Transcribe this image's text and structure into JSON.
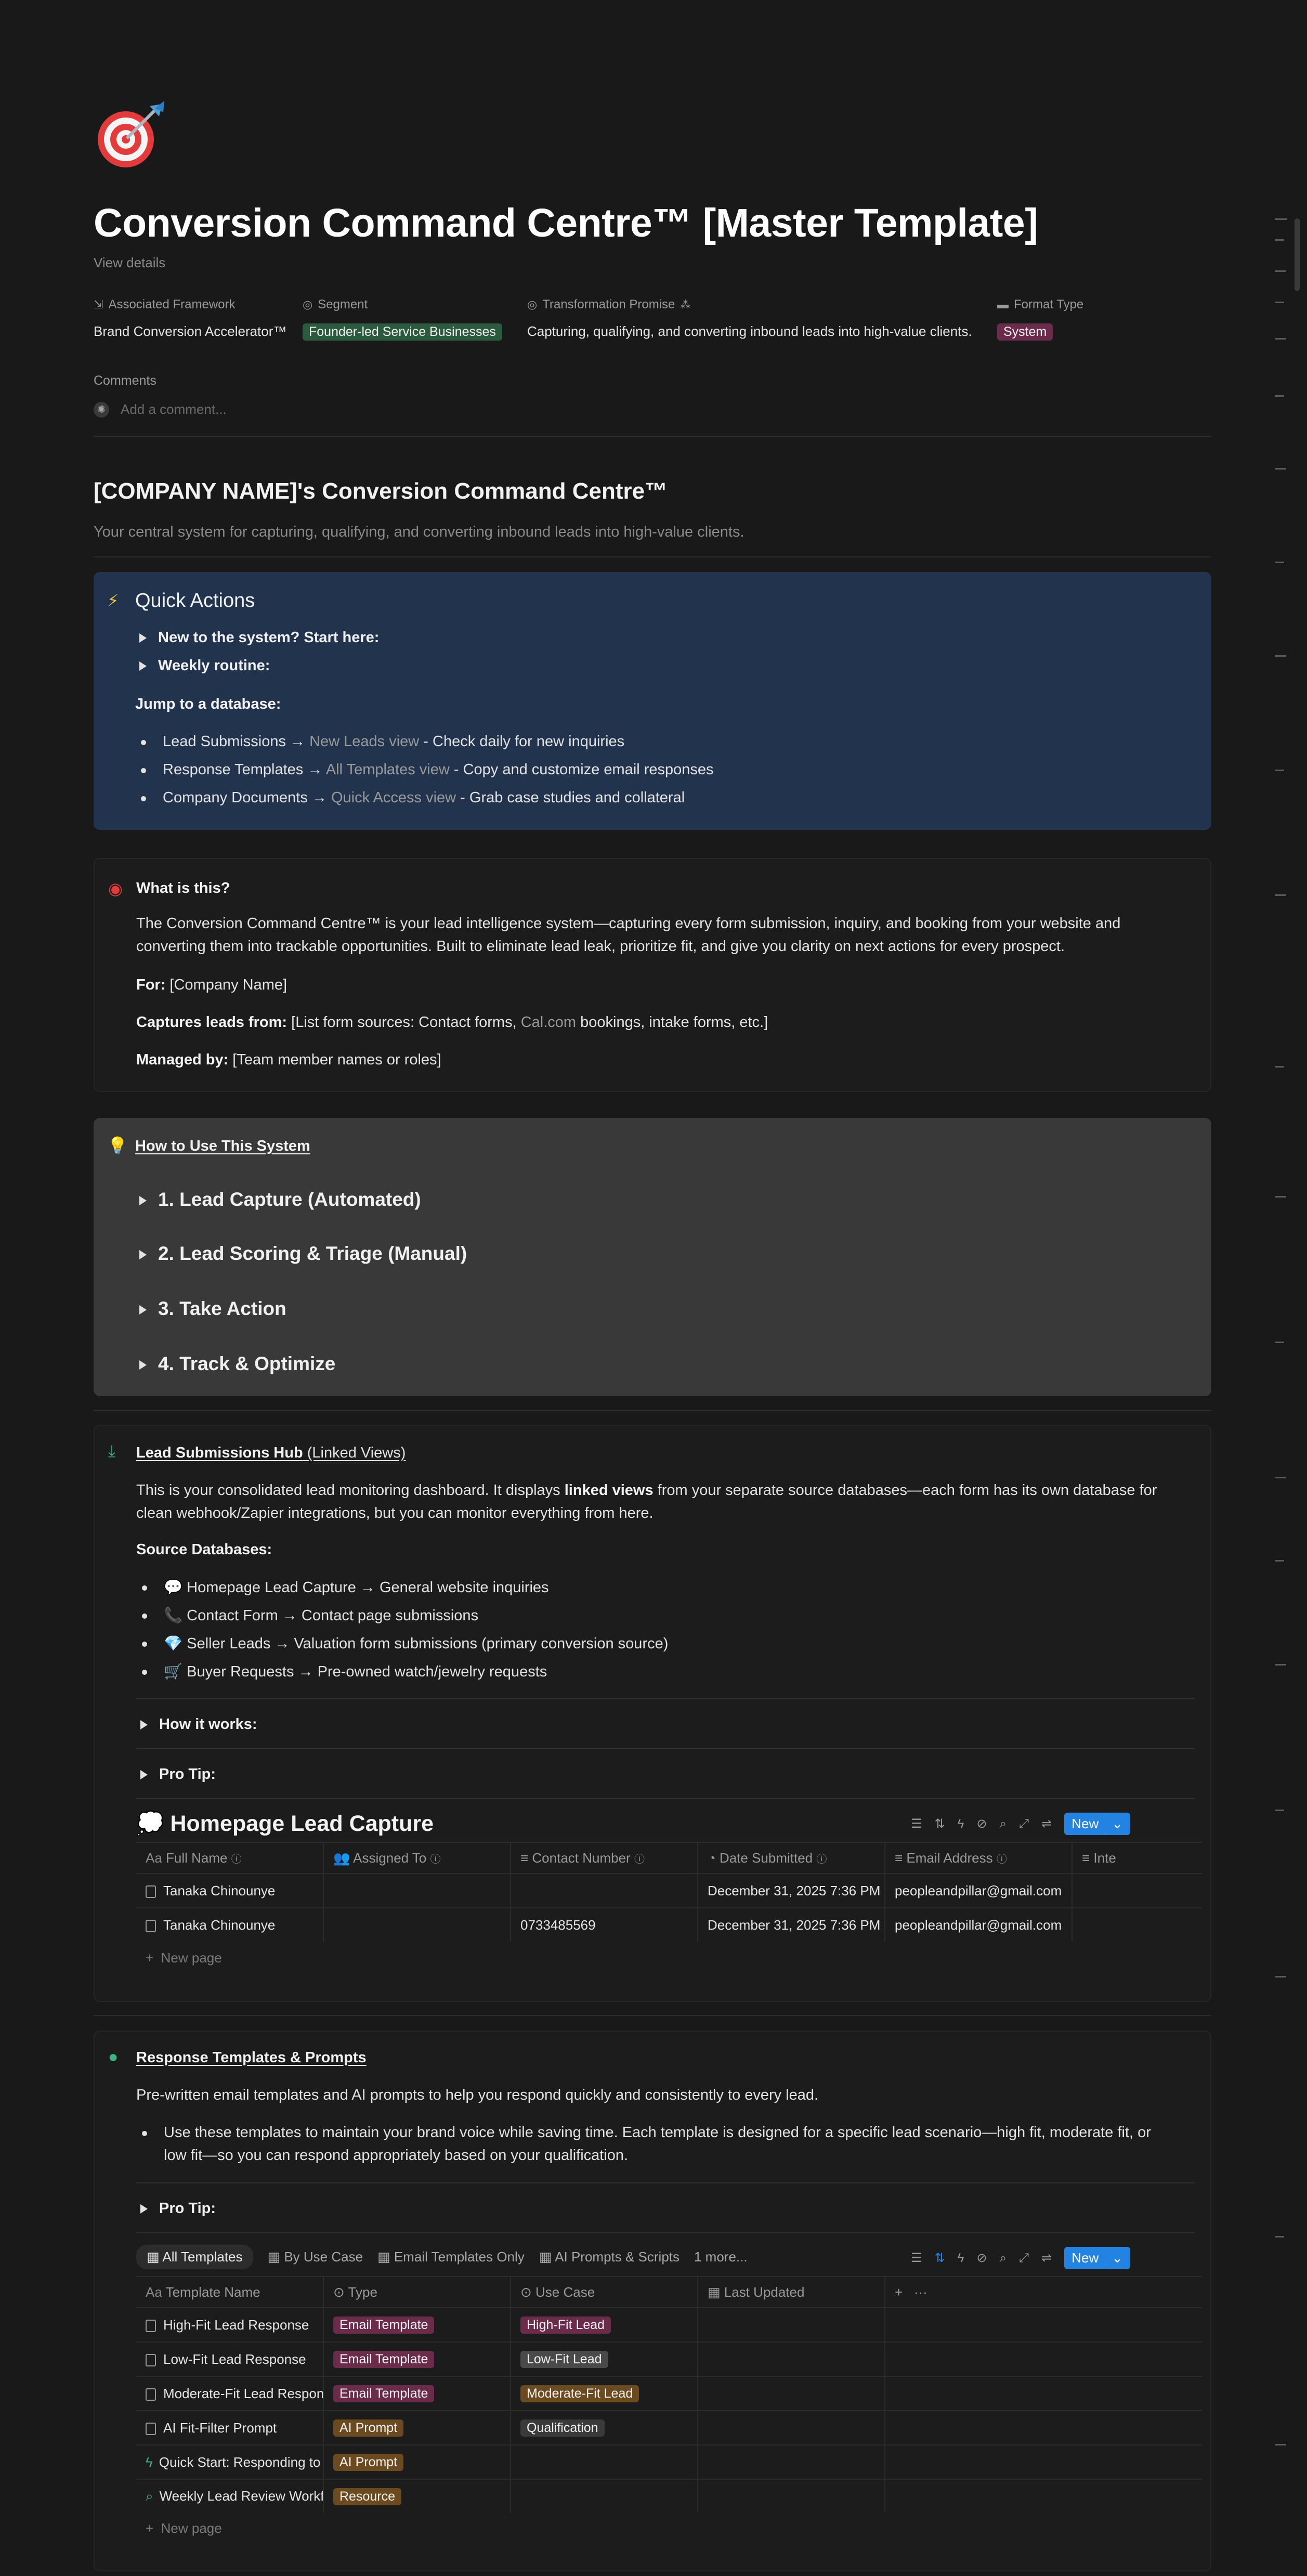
{
  "page": {
    "icon": "target-dart-icon",
    "title": "Conversion Command Centre™ [Master Template]",
    "view_details": "View details",
    "properties": {
      "framework_label": "Associated Framework",
      "framework_value": "Brand Conversion Accelerator™",
      "segment_label": "Segment",
      "segment_value": "Founder-led Service Businesses",
      "promise_label": "Transformation Promise",
      "promise_value": "Capturing, qualifying, and converting inbound leads into high-value clients.",
      "format_label": "Format Type",
      "format_value": "System"
    },
    "comments_label": "Comments",
    "comment_placeholder": "Add a comment..."
  },
  "heading": {
    "title": "[COMPANY NAME]'s Conversion Command Centre™",
    "subtitle": "Your central system for capturing, qualifying, and converting inbound leads into high-value clients."
  },
  "quick_actions": {
    "icon": "lightning-icon",
    "title": "Quick Actions",
    "toggle1": "New to the system? Start here:",
    "toggle2": "Weekly routine:",
    "jump": "Jump to a database:",
    "items": [
      {
        "pre": "Lead Submissions → ",
        "link": "New Leads view",
        "post": " - Check daily for new inquiries"
      },
      {
        "pre": "Response Templates → ",
        "link": "All Templates view",
        "post": " - Copy and customize email responses"
      },
      {
        "pre": "Company Documents → ",
        "link": "Quick Access view",
        "post": " - Grab case studies and collateral"
      }
    ]
  },
  "what_is_this": {
    "title": "What is this?",
    "para1": "The Conversion Command Centre™ is your lead intelligence system—capturing every form submission, inquiry, and booking from your website and",
    "para2": "converting them into trackable opportunities. Built to eliminate lead leak, prioritize fit, and give you clarity on next actions for every prospect.",
    "for_label": "For:",
    "for_value": " [Company Name]",
    "captures_label": "Captures leads from:",
    "captures_pre": " [List form sources: Contact forms, ",
    "captures_link": "Cal.com",
    "captures_post": " bookings, intake forms, etc.]",
    "managed_label": "Managed by:",
    "managed_value": " [Team member names or roles]"
  },
  "how_to": {
    "title": "How to Use This System",
    "steps": [
      "1. Lead Capture (Automated)",
      "2. Lead Scoring & Triage (Manual)",
      "3. Take Action",
      "4. Track & Optimize"
    ]
  },
  "lead_hub": {
    "title": "Lead Submissions Hub",
    "title_suffix": " (Linked Views)",
    "desc1_pre": "This is your consolidated lead monitoring dashboard. It displays ",
    "desc1_bold": "linked views",
    "desc1_post": " from your separate source databases—each form has its own database for",
    "desc2": "clean webhook/Zapier integrations, but you can monitor everything from here.",
    "sources_label": "Source Databases:",
    "sources": [
      "💬 Homepage Lead Capture → General website inquiries",
      "📞 Contact Form → Contact page submissions",
      "💎 Seller Leads → Valuation form submissions (primary conversion source)",
      "🛒 Buyer Requests → Pre-owned watch/jewelry requests"
    ],
    "toggle_how": "How it works:",
    "toggle_tip": "Pro Tip:",
    "db_title": "💭 Homepage Lead Capture",
    "new_label": "New",
    "columns": [
      "Full Name",
      "Assigned To",
      "Contact Number",
      "Date Submitted",
      "Email Address",
      "Inte"
    ],
    "rows": [
      [
        "Tanaka Chinounye",
        "",
        "",
        "December 31, 2025 7:36 PM",
        "peopleandpillar@gmail.com",
        ""
      ],
      [
        "Tanaka Chinounye",
        "",
        "0733485569",
        "December 31, 2025 7:36 PM",
        "peopleandpillar@gmail.com",
        ""
      ]
    ],
    "new_page": "New page"
  },
  "templates": {
    "title": "Response Templates & Prompts",
    "desc": "Pre-written email templates and AI prompts to help you respond quickly and consistently to every lead.",
    "bullet1": "Use these templates to maintain your brand voice while saving time. Each template is designed for a specific lead scenario—high fit, moderate fit, or",
    "bullet2": "low fit—so you can respond appropriately based on your qualification.",
    "toggle_tip": "Pro Tip:",
    "tabs": [
      "All Templates",
      "By Use Case",
      "Email Templates Only",
      "AI Prompts & Scripts",
      "1 more..."
    ],
    "new_label": "New",
    "columns": [
      "Template Name",
      "Type",
      "Use Case",
      "Last Updated"
    ],
    "rows": [
      {
        "name": "High-Fit Lead Response",
        "icon": "doc",
        "type": "Email Template",
        "type_color": "pink",
        "use": "High-Fit Lead",
        "use_color": "pink"
      },
      {
        "name": "Low-Fit Lead Response",
        "icon": "doc",
        "type": "Email Template",
        "type_color": "pink",
        "use": "Low-Fit Lead",
        "use_color": "gray2"
      },
      {
        "name": "Moderate-Fit Lead Response",
        "icon": "doc",
        "type": "Email Template",
        "type_color": "pink",
        "use": "Moderate-Fit Lead",
        "use_color": "brown"
      },
      {
        "name": "AI Fit-Filter Prompt",
        "icon": "doc",
        "type": "AI Prompt",
        "type_color": "brown",
        "use": "Qualification",
        "use_color": "gray"
      },
      {
        "name": "Quick Start: Responding to Your F...",
        "icon": "bolt",
        "type": "AI Prompt",
        "type_color": "brown",
        "use": "",
        "use_color": ""
      },
      {
        "name": "Weekly Lead Review Workflow",
        "icon": "search",
        "type": "Resource",
        "type_color": "brown",
        "use": "",
        "use_color": ""
      }
    ],
    "new_page": "New page"
  },
  "colors": {
    "background": "#191919",
    "quick_actions": "#22344d",
    "how_to": "#393939",
    "accent_blue": "#2383e2"
  }
}
